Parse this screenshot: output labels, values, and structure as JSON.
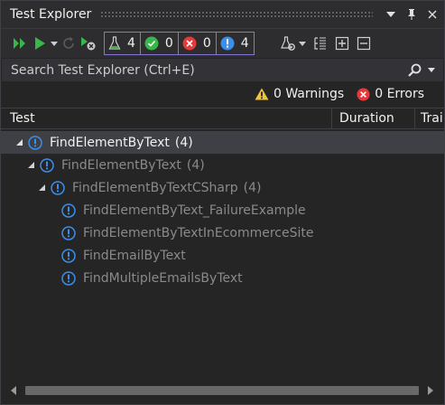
{
  "window": {
    "title": "Test Explorer"
  },
  "title_buttons": {
    "menu_icon": "chevron-down-icon",
    "pin_icon": "pin-icon",
    "close_icon": "close-icon"
  },
  "toolbar": {
    "filters": [
      {
        "name": "total",
        "icon": "flask-icon",
        "count": "4"
      },
      {
        "name": "passed",
        "icon": "check-circle-icon",
        "count": "0"
      },
      {
        "name": "failed",
        "icon": "x-circle-icon",
        "count": "0"
      },
      {
        "name": "not-run",
        "icon": "info-circle-icon",
        "count": "4"
      }
    ]
  },
  "search": {
    "placeholder": "Search Test Explorer (Ctrl+E)"
  },
  "summary": {
    "warnings": "0 Warnings",
    "errors": "0 Errors"
  },
  "columns": {
    "test": "Test",
    "duration": "Duration",
    "traits": "Trai"
  },
  "tree": [
    {
      "label": "FindElementByText",
      "count": "(4)",
      "level": 0,
      "expanded": true,
      "selected": true
    },
    {
      "label": "FindElementByText",
      "count": "(4)",
      "level": 1,
      "expanded": true,
      "selected": false
    },
    {
      "label": "FindElementByTextCSharp",
      "count": "(4)",
      "level": 2,
      "expanded": true,
      "selected": false
    },
    {
      "label": "FindElementByText_FailureExample",
      "count": "",
      "level": 3,
      "expanded": false,
      "selected": false
    },
    {
      "label": "FindElementByTextInEcommerceSite",
      "count": "",
      "level": 3,
      "expanded": false,
      "selected": false
    },
    {
      "label": "FindEmailByText",
      "count": "",
      "level": 3,
      "expanded": false,
      "selected": false
    },
    {
      "label": "FindMultipleEmailsByText",
      "count": "",
      "level": 3,
      "expanded": false,
      "selected": false
    }
  ],
  "colors": {
    "accent": "#8377d6",
    "passed": "#3ab549",
    "failed": "#e5393a",
    "not_run": "#3b8eea",
    "warning": "#f0c33c"
  }
}
